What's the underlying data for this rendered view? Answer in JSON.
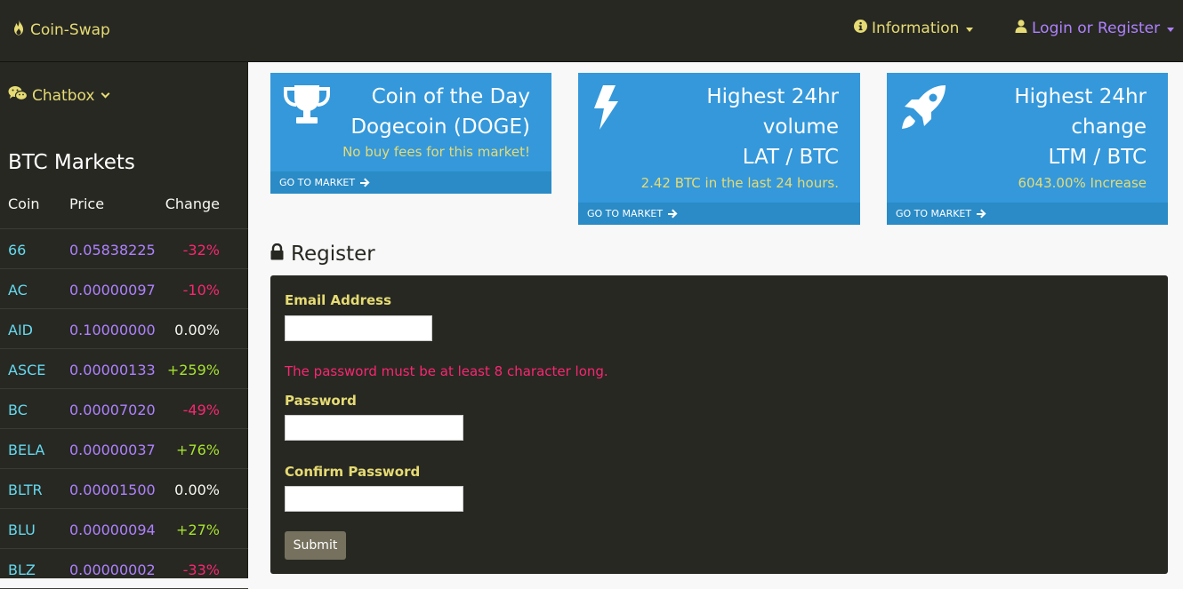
{
  "nav": {
    "brand": "Coin-Swap",
    "information": "Information",
    "login": "Login or Register"
  },
  "sidebar": {
    "chatbox": "Chatbox",
    "markets_title": "BTC Markets",
    "headers": {
      "coin": "Coin",
      "price": "Price",
      "change": "Change"
    },
    "rows": [
      {
        "coin": "66",
        "price": "0.05838225",
        "change": "-32%"
      },
      {
        "coin": "AC",
        "price": "0.00000097",
        "change": "-10%"
      },
      {
        "coin": "AID",
        "price": "0.10000000",
        "change": "0.00%"
      },
      {
        "coin": "ASCE",
        "price": "0.00000133",
        "change": "+259%"
      },
      {
        "coin": "BC",
        "price": "0.00007020",
        "change": "-49%"
      },
      {
        "coin": "BELA",
        "price": "0.00000037",
        "change": "+76%"
      },
      {
        "coin": "BLTR",
        "price": "0.00001500",
        "change": "0.00%"
      },
      {
        "coin": "BLU",
        "price": "0.00000094",
        "change": "+27%"
      },
      {
        "coin": "BLZ",
        "price": "0.00000002",
        "change": "-33%"
      }
    ]
  },
  "panels": [
    {
      "icon": "trophy-icon",
      "title_lines": [
        "Coin of the Day",
        "Dogecoin (DOGE)"
      ],
      "subtitle": "No buy fees for this market!",
      "footer": "GO TO MARKET"
    },
    {
      "icon": "bolt-icon",
      "title_lines": [
        "Highest 24hr",
        "volume",
        "LAT / BTC"
      ],
      "subtitle": "2.42 BTC in the last 24 hours.",
      "footer": "GO TO MARKET"
    },
    {
      "icon": "rocket-icon",
      "title_lines": [
        "Highest 24hr",
        "change",
        "LTM / BTC"
      ],
      "subtitle": "6043.00% Increase",
      "footer": "GO TO MARKET"
    }
  ],
  "register": {
    "heading": "Register",
    "email_label": "Email Address",
    "email_value": "",
    "error": "The password must be at least 8 character long.",
    "password_label": "Password",
    "password_value": "",
    "confirm_label": "Confirm Password",
    "confirm_value": "",
    "submit": "Submit"
  },
  "colors": {
    "dark_bg": "#272822",
    "yellow": "#e6db74",
    "purple": "#ae81ff",
    "cyan": "#66d9ef",
    "red": "#f92672",
    "green": "#a6e22e",
    "panel_blue": "#3498db"
  }
}
